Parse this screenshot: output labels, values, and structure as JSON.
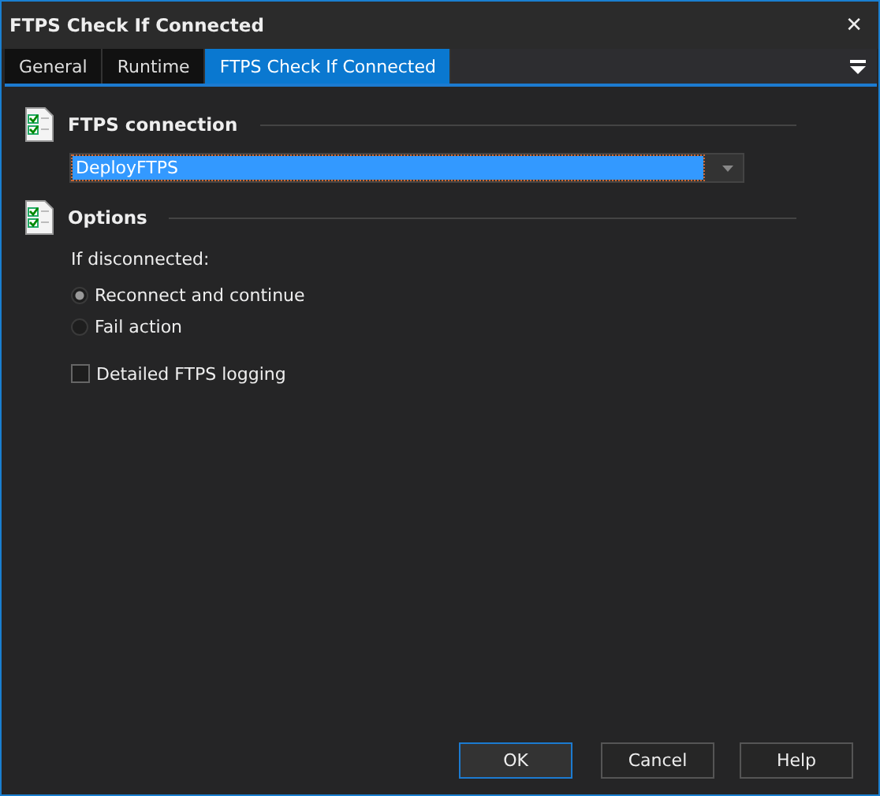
{
  "window": {
    "title": "FTPS Check If Connected",
    "close": "✕"
  },
  "tabs": [
    {
      "label": "General",
      "selected": false
    },
    {
      "label": "Runtime",
      "selected": false
    },
    {
      "label": "FTPS Check If Connected",
      "selected": true
    }
  ],
  "connection": {
    "heading": "FTPS connection",
    "value": "DeployFTPS"
  },
  "options": {
    "heading": "Options",
    "prompt": "If disconnected:",
    "radios": [
      {
        "label": "Reconnect and continue",
        "selected": true
      },
      {
        "label": "Fail action",
        "selected": false
      }
    ],
    "checkbox": {
      "label": "Detailed FTPS logging",
      "checked": false
    }
  },
  "buttons": [
    {
      "label": "OK",
      "default": true
    },
    {
      "label": "Cancel",
      "default": false
    },
    {
      "label": "Help",
      "default": false
    }
  ]
}
